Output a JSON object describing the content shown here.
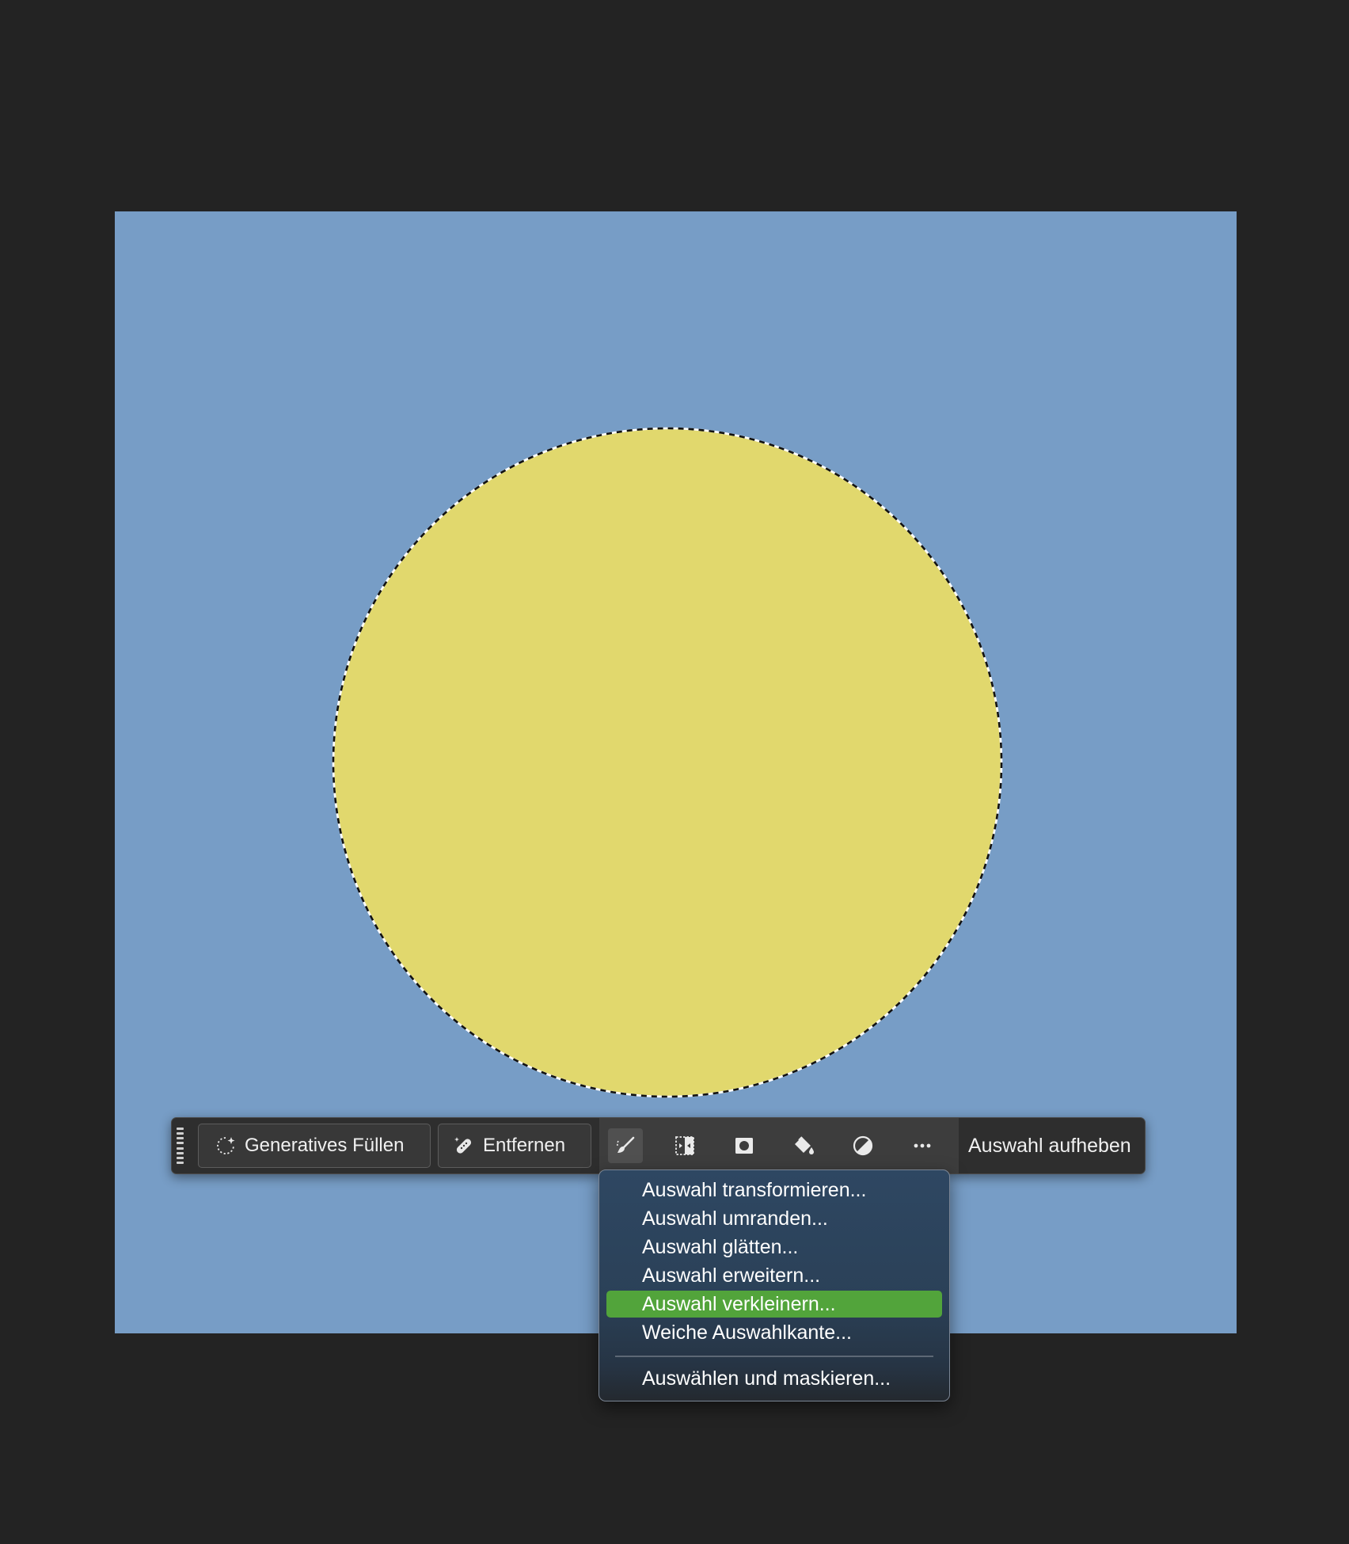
{
  "colors": {
    "workspace": "#232323",
    "canvas": "#779dc6",
    "shape": "#e1d86d",
    "taskbar": "#2e2e2e",
    "menu_highlight": "#52a43b"
  },
  "taskbar": {
    "generative_fill_label": "Generatives Füllen",
    "remove_label": "Entfernen",
    "deselect_label": "Auswahl aufheben",
    "icons": [
      "modify-selection-brush-icon",
      "invert-selection-icon",
      "create-mask-icon",
      "fill-bucket-icon",
      "adjustment-layer-icon",
      "more-options-icon"
    ]
  },
  "menu": {
    "items": [
      {
        "label": "Auswahl transformieren..."
      },
      {
        "label": "Auswahl umranden..."
      },
      {
        "label": "Auswahl glätten..."
      },
      {
        "label": "Auswahl erweitern..."
      },
      {
        "label": "Auswahl verkleinern...",
        "highlighted": true
      },
      {
        "label": "Weiche Auswahlkante..."
      }
    ],
    "footer_item": "Auswählen und maskieren..."
  }
}
